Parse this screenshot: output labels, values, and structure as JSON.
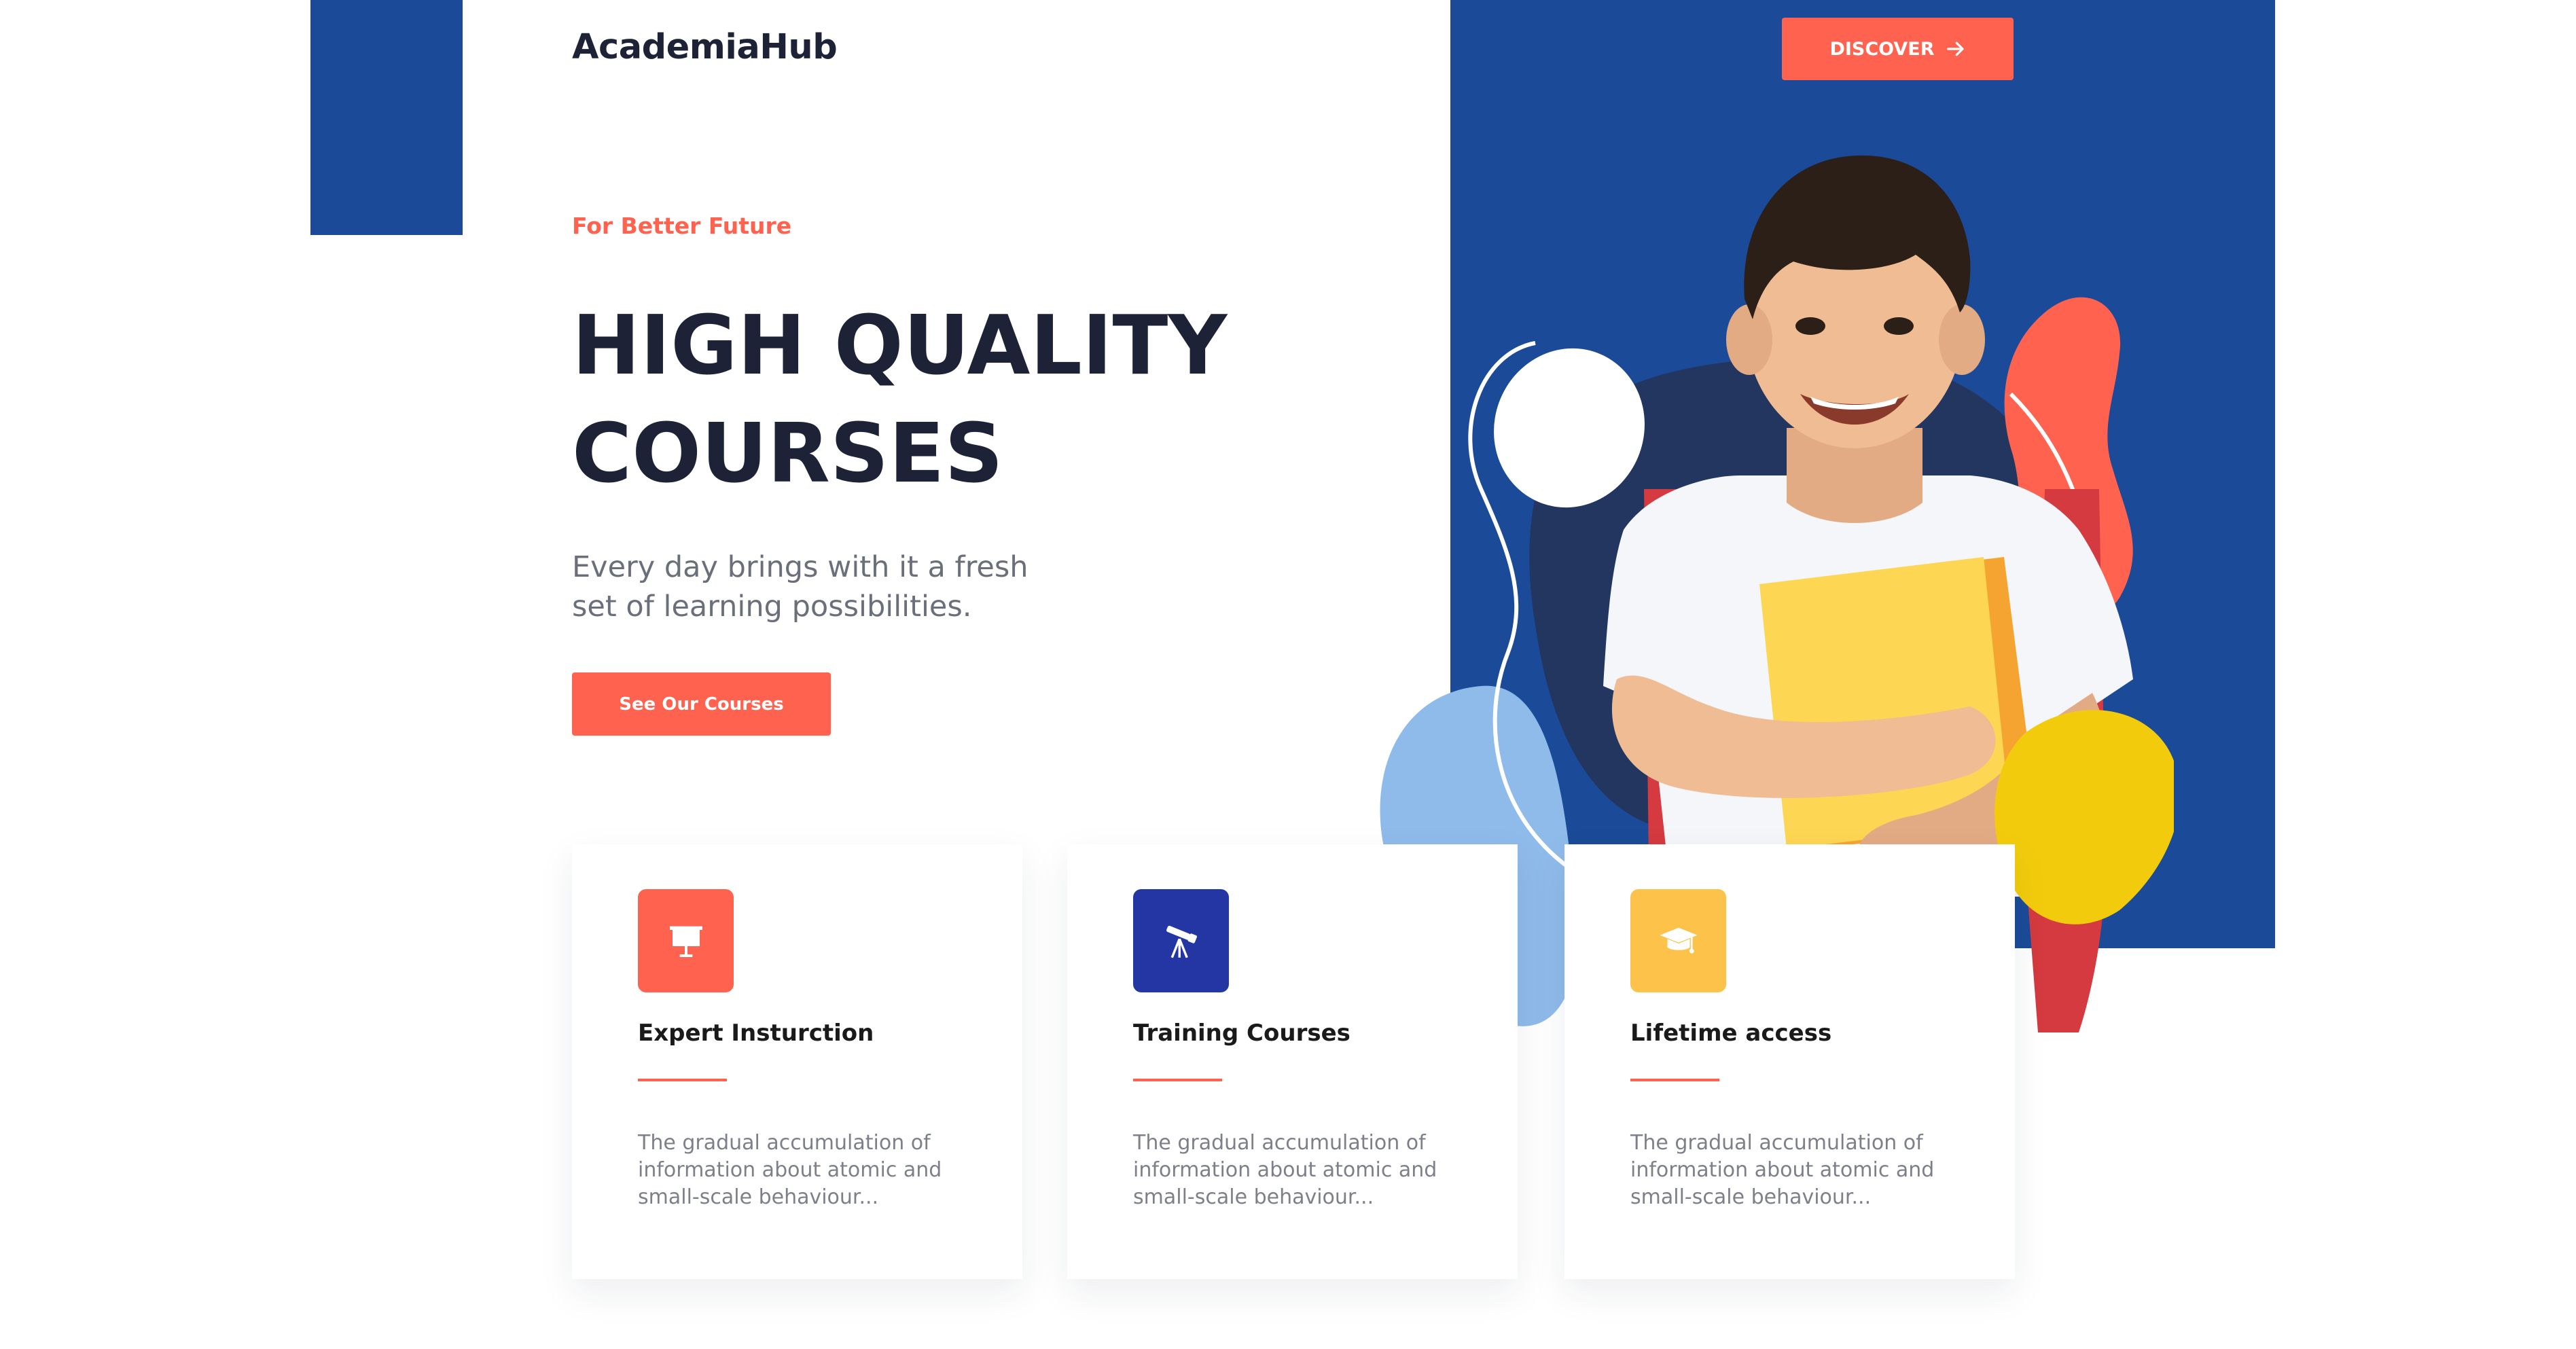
{
  "brand": {
    "logo_text": "AcademiaHub"
  },
  "header": {
    "discover_label": "DISCOVER",
    "discover_icon": "arrow-right-icon"
  },
  "hero": {
    "tagline": "For Better Future",
    "headline_lines": [
      "HIGH QUALITY",
      "COURSES"
    ],
    "subtext_lines": [
      "Every day brings with it a fresh",
      "set of learning possibilities."
    ],
    "cta_label": "See Our Courses"
  },
  "features": [
    {
      "icon": "presentation-board-icon",
      "icon_color": "#ff634f",
      "title": "Expert Insturction",
      "desc": "The gradual accumulation of information about atomic and small-scale behaviour..."
    },
    {
      "icon": "telescope-icon",
      "icon_color": "#2436a3",
      "title": "Training Courses",
      "desc": "The gradual accumulation of information about atomic and small-scale behaviour..."
    },
    {
      "icon": "graduation-cap-icon",
      "icon_color": "#fcc24a",
      "title": "Lifetime access",
      "desc": "The gradual accumulation of information about atomic and small-scale behaviour..."
    }
  ],
  "colors": {
    "brand_blue": "#1b4b98",
    "accent_coral": "#ff634f",
    "heading_dark": "#1d2236"
  }
}
